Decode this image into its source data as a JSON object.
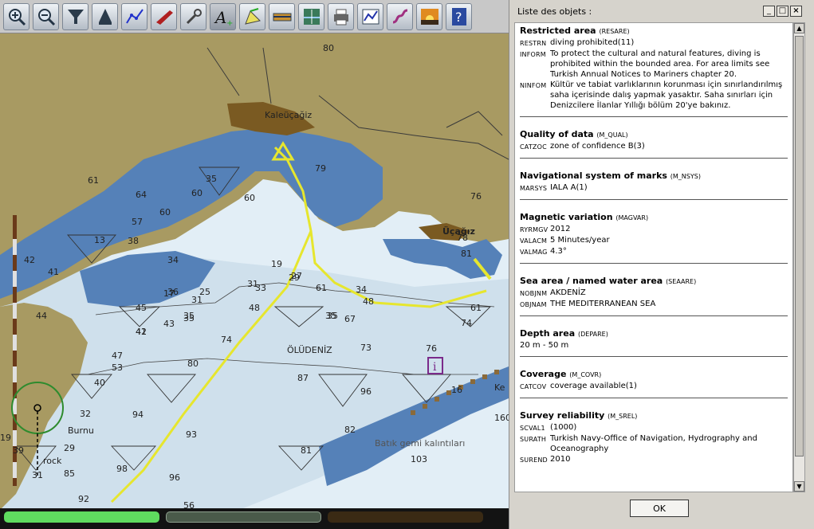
{
  "toolbar": {
    "buttons": [
      {
        "name": "zoom-in-button",
        "icon": "magnifier-plus-icon"
      },
      {
        "name": "zoom-out-button",
        "icon": "magnifier-minus-icon"
      },
      {
        "name": "filter-button",
        "icon": "funnel-icon"
      },
      {
        "name": "ship-position-button",
        "icon": "ship-icon"
      },
      {
        "name": "route-button",
        "icon": "route-icon"
      },
      {
        "name": "boat-button",
        "icon": "boat-icon"
      },
      {
        "name": "tools-button",
        "icon": "wrench-icon"
      },
      {
        "name": "text-size-button",
        "icon": "text-a-plus-icon"
      },
      {
        "name": "pen-button",
        "icon": "pen-icon"
      },
      {
        "name": "ruler-button",
        "icon": "ruler-icon"
      },
      {
        "name": "depth-button",
        "icon": "depth-icon"
      },
      {
        "name": "print-button",
        "icon": "printer-icon"
      },
      {
        "name": "graph-button",
        "icon": "chart-icon"
      },
      {
        "name": "track-button",
        "icon": "track-icon"
      },
      {
        "name": "night-mode-button",
        "icon": "sunset-icon"
      },
      {
        "name": "help-button",
        "icon": "help-icon"
      }
    ]
  },
  "chart": {
    "place_labels": [
      "Kaleüçağiz",
      "Üçağız",
      "ÖLÜDENİZ",
      "Batık gemi kalıntıları",
      "rock",
      "Burnu",
      "Ke"
    ],
    "soundings": [
      "80",
      "79",
      "76",
      "60",
      "64",
      "60",
      "61",
      "57",
      "60",
      "42",
      "41",
      "35",
      "38",
      "35",
      "31",
      "36",
      "31",
      "34",
      "44",
      "41",
      "33",
      "27",
      "25",
      "19",
      "17",
      "13",
      "45",
      "43",
      "35",
      "48",
      "42",
      "35",
      "67",
      "35",
      "29",
      "61",
      "34",
      "74",
      "73",
      "76",
      "47",
      "53",
      "80",
      "87",
      "96",
      "94",
      "93",
      "82",
      "40",
      "32",
      "19",
      "39",
      "29",
      "31",
      "85",
      "81",
      "98",
      "96",
      "92",
      "56",
      "81",
      "78",
      "16",
      "160",
      "74",
      "48",
      "61",
      "103"
    ],
    "colors": {
      "land": "#a89a62",
      "shallow": "#5581b8",
      "medium": "#cfe0ec",
      "deep": "#e2eef6",
      "track": "#e6e62e",
      "selection": "#2e8b2e"
    }
  },
  "bottom_bars": [
    {
      "color": "#5fdc5f"
    },
    {
      "color": "#4a5a4a"
    },
    {
      "color": "#3a2a14"
    }
  ],
  "dialog": {
    "title": "Liste des objets :",
    "window_buttons": {
      "minimize": "_",
      "maximize": "□",
      "close": "×"
    },
    "ok_label": "OK",
    "sections": [
      {
        "title": "Restricted area",
        "code": "(RESARE)",
        "rows": [
          {
            "acr": "RESTRN",
            "val": "diving prohibited(11)"
          },
          {
            "acr": "INFORM",
            "val": "To protect the cultural and natural features, diving is prohibited within the bounded area. For area limits see Turkish Annual Notices to Mariners chapter 20."
          },
          {
            "acr": "NINFOM",
            "val": "Kültür ve tabiat varlıklarının korunması için sınırlandırılmış saha içerisinde dalış yapmak yasaktır. Saha sınırları için Denizcilere İlanlar Yıllığı bölüm 20'ye bakınız."
          }
        ]
      },
      {
        "title": "Quality of data",
        "code": "(M_QUAL)",
        "rows": [
          {
            "acr": "CATZOC",
            "val": "zone of confidence B(3)"
          }
        ]
      },
      {
        "title": "Navigational system of marks",
        "code": "(M_NSYS)",
        "rows": [
          {
            "acr": "MARSYS",
            "val": "IALA A(1)"
          }
        ]
      },
      {
        "title": "Magnetic variation",
        "code": "(MAGVAR)",
        "rows": [
          {
            "acr": "RYRMGV",
            "val": "2012"
          },
          {
            "acr": "VALACM",
            "val": "5 Minutes/year"
          },
          {
            "acr": "VALMAG",
            "val": "4.3°"
          }
        ]
      },
      {
        "title": "Sea area / named water area",
        "code": "(SEAARE)",
        "rows": [
          {
            "acr": "NOBJNM",
            "val": "AKDENİZ"
          },
          {
            "acr": "OBJNAM",
            "val": "THE MEDITERRANEAN SEA"
          }
        ]
      },
      {
        "title": "Depth area",
        "code": "(DEPARE)",
        "rows": [
          {
            "acr": "",
            "val": "20 m - 50 m"
          }
        ]
      },
      {
        "title": "Coverage",
        "code": "(M_COVR)",
        "rows": [
          {
            "acr": "CATCOV",
            "val": "coverage available(1)"
          }
        ]
      },
      {
        "title": "Survey reliability",
        "code": "(M_SREL)",
        "rows": [
          {
            "acr": "SCVAL1",
            "val": "(1000)"
          },
          {
            "acr": "SURATH",
            "val": "Turkish Navy-Office of Navigation, Hydrography and Oceanography"
          },
          {
            "acr": "SUREND",
            "val": "2010"
          }
        ]
      }
    ]
  }
}
